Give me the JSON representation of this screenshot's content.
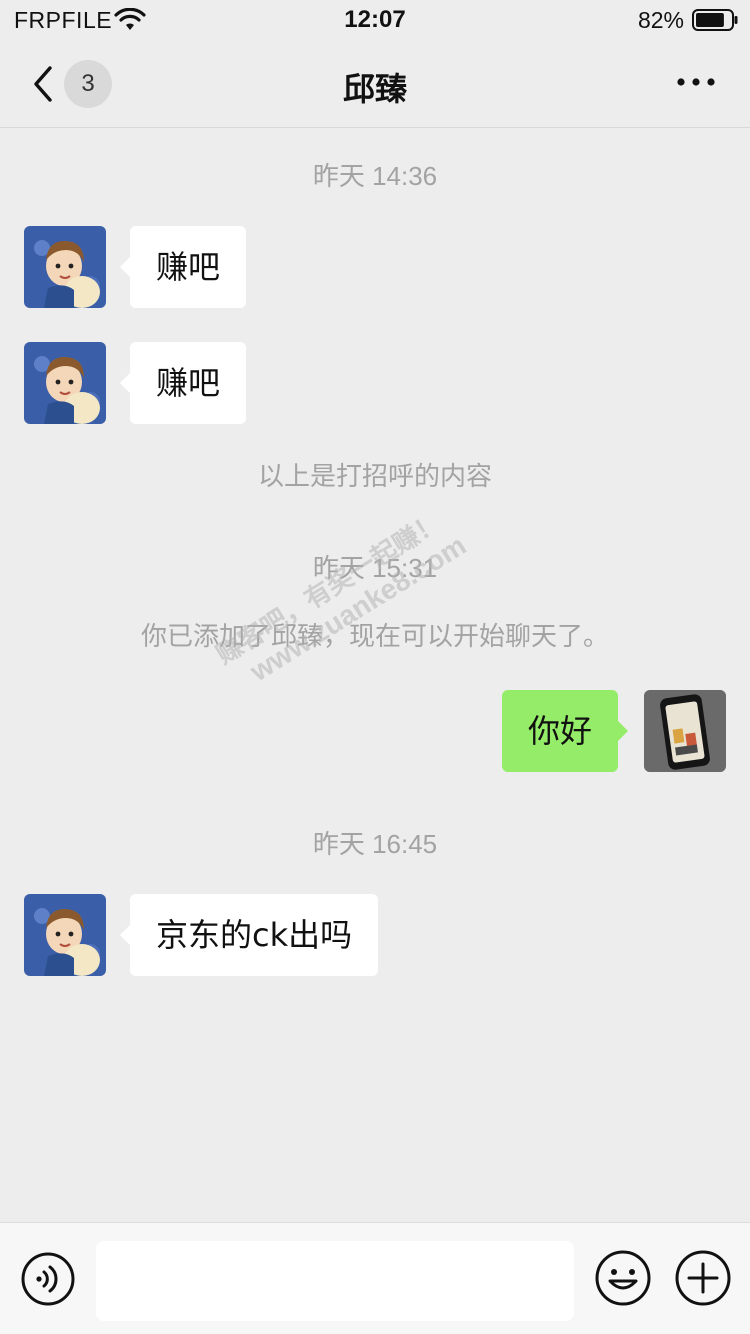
{
  "status_bar": {
    "carrier": "FRPFILE",
    "time": "12:07",
    "battery_percent": "82%",
    "battery_level": 0.82,
    "wifi_icon": "wifi-icon",
    "battery_icon": "battery-icon"
  },
  "nav": {
    "back_icon": "chevron-left-icon",
    "unread_count": "3",
    "title": "邱臻",
    "more_icon": "more-dots-icon"
  },
  "chat": {
    "timestamps": [
      "昨天 14:36",
      "昨天 15:31",
      "昨天 16:45"
    ],
    "messages": [
      {
        "side": "left",
        "text": "赚吧"
      },
      {
        "side": "left",
        "text": "赚吧"
      },
      {
        "side": "right",
        "text": "你好"
      },
      {
        "side": "left",
        "text": "京东的ck出吗"
      }
    ],
    "system_notes": [
      "以上是打招呼的内容",
      "你已添加了邱臻，现在可以开始聊天了。"
    ]
  },
  "watermark": {
    "line1": "赚客吧，有奖一起赚！",
    "line2": "www.zuanke8.com"
  },
  "input_bar": {
    "voice_icon": "voice-icon",
    "input_value": "",
    "emoji_icon": "emoji-icon",
    "plus_icon": "plus-circle-icon"
  },
  "colors": {
    "background": "#ededed",
    "bubble_self": "#95ec69",
    "bubble_other": "#ffffff",
    "meta_text": "#a3a3a3"
  }
}
